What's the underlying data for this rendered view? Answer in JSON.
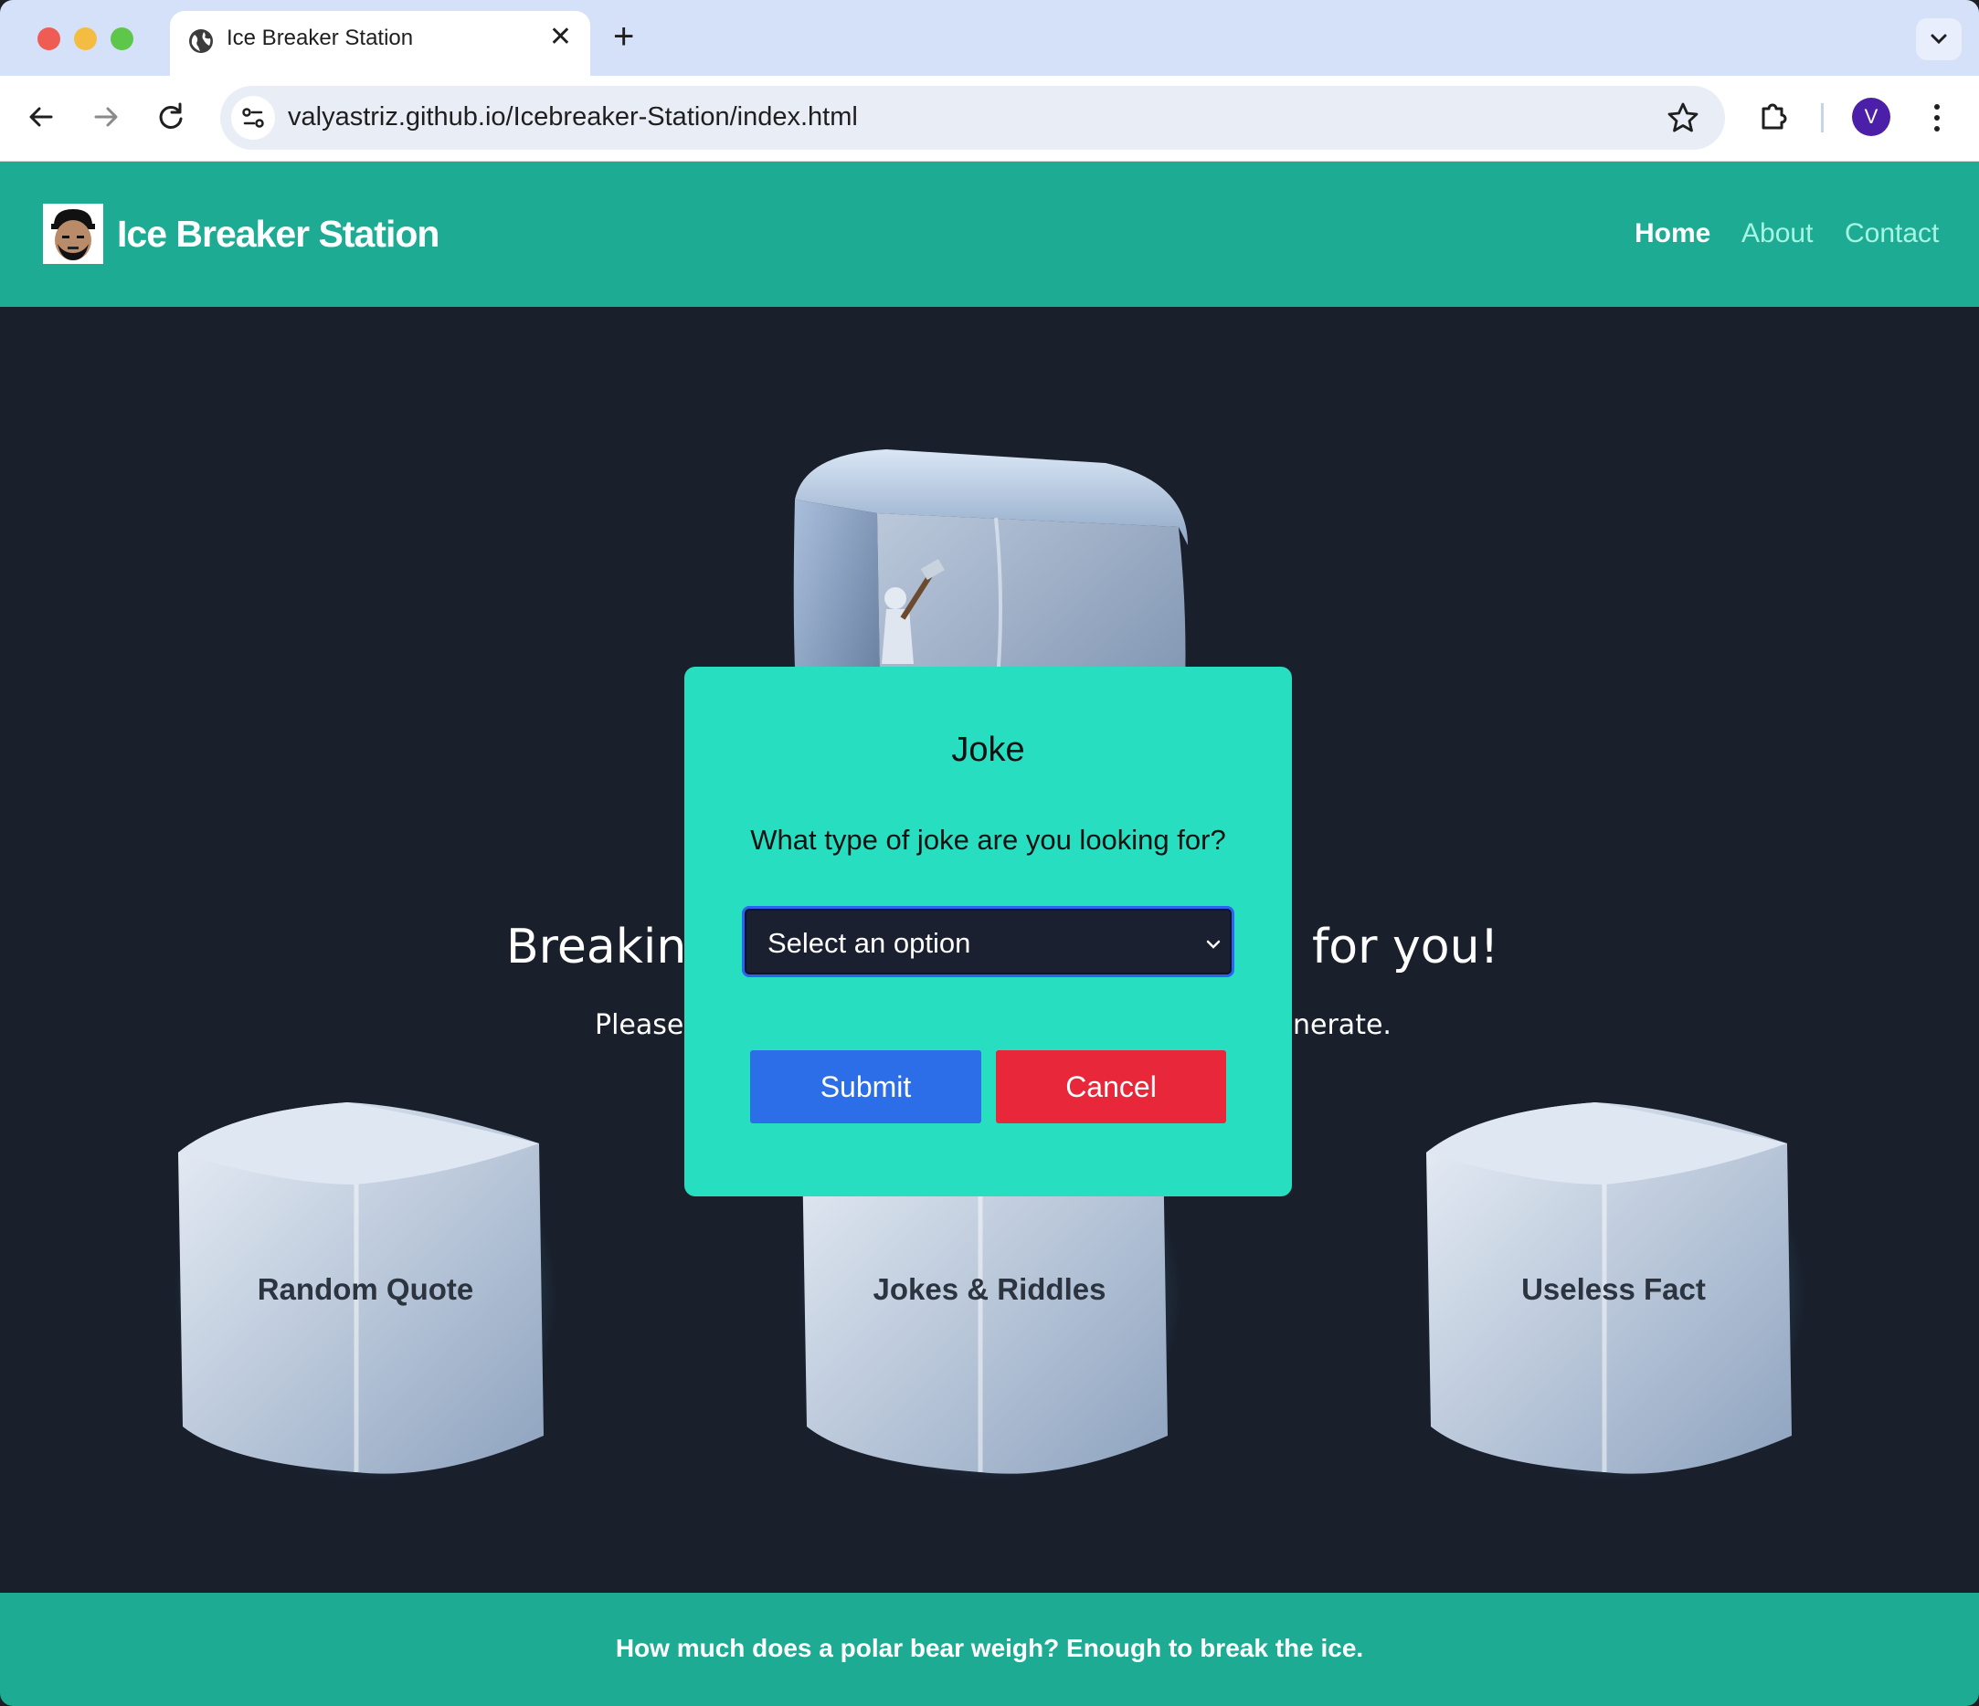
{
  "browser": {
    "tab_title": "Ice Breaker Station",
    "tab_close": "✕",
    "new_tab": "+",
    "url": "valyastriz.github.io/Icebreaker-Station/index.html",
    "profile_initial": "V"
  },
  "header": {
    "brand": "Ice Breaker Station",
    "nav": [
      {
        "label": "Home",
        "active": true
      },
      {
        "label": "About",
        "active": false
      },
      {
        "label": "Contact",
        "active": false
      }
    ]
  },
  "hero": {
    "title_left": "Breaking",
    "title_right": "for you!",
    "subtitle_left": "Please",
    "subtitle_right": "nerate."
  },
  "cards": [
    {
      "label": "Random Quote"
    },
    {
      "label": "Jokes & Riddles"
    },
    {
      "label": "Useless Fact"
    }
  ],
  "modal": {
    "title": "Joke",
    "question": "What type of joke are you looking for?",
    "select_value": "Select an option",
    "submit_label": "Submit",
    "cancel_label": "Cancel"
  },
  "footer": {
    "text": "How much does a polar bear weigh? Enough to break the ice."
  },
  "colors": {
    "header_bg": "#1dab93",
    "page_bg": "#1a1f2c",
    "modal_bg": "#27dfc0",
    "submit": "#2c6de8",
    "cancel": "#e8283a"
  }
}
